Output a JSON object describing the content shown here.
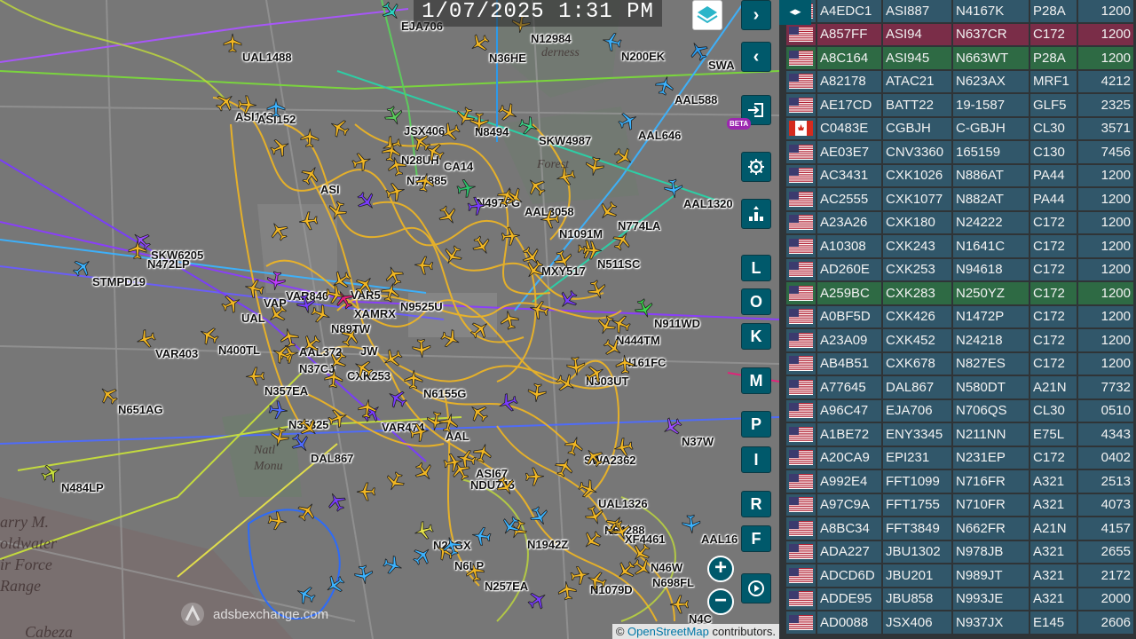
{
  "clock": "1/07/2025 1:31 PM",
  "attribution": {
    "prefix": "©",
    "link": "OpenStreetMap",
    "suffix": "contributors."
  },
  "watermark": "adsbexchange.com",
  "beta": "BETA",
  "places": [
    "arry M.",
    "oldwater",
    "ir Force",
    "Range",
    "Cabeza",
    "Natl",
    "Monu",
    "derness",
    "Forest"
  ],
  "map_buttons": {
    "layers": "layers-icon",
    "next": "›",
    "prev": "‹",
    "login": "login-icon",
    "settings": "gear-icon",
    "altitude": "altitude-icon",
    "keys": [
      "L",
      "O",
      "K",
      "M",
      "P",
      "I",
      "R",
      "F"
    ],
    "zoom_in": "+",
    "zoom_out": "−",
    "replay": "replay-icon"
  },
  "panel_toggle": "◂▸",
  "aircraft_labels": [
    "UAL1488",
    "ASI142",
    "ASI152",
    "EJA706",
    "N12984",
    "N36HE",
    "N200EK",
    "SWA",
    "AAL588",
    "AAL646",
    "SKW4987",
    "JSX406",
    "N8494",
    "N28UH",
    "CA14",
    "N72885",
    "ASI",
    "N497FG",
    "AAL3058",
    "AAL1320",
    "N774LA",
    "N1091M",
    "SKW6205",
    "N472LP",
    "STMPD19",
    "N511SC",
    "MXY517",
    "VAR840",
    "VAR5",
    "VAP",
    "XAMRX",
    "N9525U",
    "UAL",
    "N89TW",
    "N911WD",
    "N444TM",
    "VAR403",
    "N400TL",
    "AAL372",
    "JW",
    "N37CJ",
    "N161FC",
    "N303UT",
    "CXK253",
    "N357EA",
    "N651AG",
    "N6155G",
    "VAR474",
    "N35325",
    "DAL867",
    "AAL",
    "N37W",
    "ASI67",
    "NDU745",
    "SWA2362",
    "N484LP",
    "UAL1326",
    "N54288",
    "N1942Z",
    "N26GX",
    "N6LP",
    "N257EA",
    "XF4461",
    "N1079D",
    "N698FL",
    "AAL16",
    "N46W",
    "N4C"
  ],
  "aircraft_table": [
    {
      "flag": "US",
      "hex": "A4EDC1",
      "callsign": "ASI887",
      "reg": "N4167K",
      "type": "P28A",
      "squawk": "1200"
    },
    {
      "flag": "US",
      "hex": "A857FF",
      "callsign": "ASI94",
      "reg": "N637CR",
      "type": "C172",
      "squawk": "1200",
      "row": "red"
    },
    {
      "flag": "US",
      "hex": "A8C164",
      "callsign": "ASI945",
      "reg": "N663WT",
      "type": "P28A",
      "squawk": "1200",
      "row": "green"
    },
    {
      "flag": "US",
      "hex": "A82178",
      "callsign": "ATAC21",
      "reg": "N623AX",
      "type": "MRF1",
      "squawk": "4212"
    },
    {
      "flag": "US",
      "hex": "AE17CD",
      "callsign": "BATT22",
      "reg": "19-1587",
      "type": "GLF5",
      "squawk": "2325"
    },
    {
      "flag": "CA",
      "hex": "C0483E",
      "callsign": "CGBJH",
      "reg": "C-GBJH",
      "type": "CL30",
      "squawk": "3571"
    },
    {
      "flag": "US",
      "hex": "AE03E7",
      "callsign": "CNV3360",
      "reg": "165159",
      "type": "C130",
      "squawk": "7456"
    },
    {
      "flag": "US",
      "hex": "AC3431",
      "callsign": "CXK1026",
      "reg": "N886AT",
      "type": "PA44",
      "squawk": "1200"
    },
    {
      "flag": "US",
      "hex": "AC2555",
      "callsign": "CXK1077",
      "reg": "N882AT",
      "type": "PA44",
      "squawk": "1200"
    },
    {
      "flag": "US",
      "hex": "A23A26",
      "callsign": "CXK180",
      "reg": "N24222",
      "type": "C172",
      "squawk": "1200"
    },
    {
      "flag": "US",
      "hex": "A10308",
      "callsign": "CXK243",
      "reg": "N1641C",
      "type": "C172",
      "squawk": "1200"
    },
    {
      "flag": "US",
      "hex": "AD260E",
      "callsign": "CXK253",
      "reg": "N94618",
      "type": "C172",
      "squawk": "1200"
    },
    {
      "flag": "US",
      "hex": "A259BC",
      "callsign": "CXK283",
      "reg": "N250YZ",
      "type": "C172",
      "squawk": "1200",
      "row": "green"
    },
    {
      "flag": "US",
      "hex": "A0BF5D",
      "callsign": "CXK426",
      "reg": "N1472P",
      "type": "C172",
      "squawk": "1200"
    },
    {
      "flag": "US",
      "hex": "A23A09",
      "callsign": "CXK452",
      "reg": "N24218",
      "type": "C172",
      "squawk": "1200"
    },
    {
      "flag": "US",
      "hex": "AB4B51",
      "callsign": "CXK678",
      "reg": "N827ES",
      "type": "C172",
      "squawk": "1200"
    },
    {
      "flag": "US",
      "hex": "A77645",
      "callsign": "DAL867",
      "reg": "N580DT",
      "type": "A21N",
      "squawk": "7732"
    },
    {
      "flag": "US",
      "hex": "A96C47",
      "callsign": "EJA706",
      "reg": "N706QS",
      "type": "CL30",
      "squawk": "0510"
    },
    {
      "flag": "US",
      "hex": "A1BE72",
      "callsign": "ENY3345",
      "reg": "N211NN",
      "type": "E75L",
      "squawk": "4343"
    },
    {
      "flag": "US",
      "hex": "A20CA9",
      "callsign": "EPI231",
      "reg": "N231EP",
      "type": "C172",
      "squawk": "0402"
    },
    {
      "flag": "US",
      "hex": "A992E4",
      "callsign": "FFT1099",
      "reg": "N716FR",
      "type": "A321",
      "squawk": "2513"
    },
    {
      "flag": "US",
      "hex": "A97C9A",
      "callsign": "FFT1755",
      "reg": "N710FR",
      "type": "A321",
      "squawk": "4073"
    },
    {
      "flag": "US",
      "hex": "A8BC34",
      "callsign": "FFT3849",
      "reg": "N662FR",
      "type": "A21N",
      "squawk": "4157"
    },
    {
      "flag": "US",
      "hex": "ADA227",
      "callsign": "JBU1302",
      "reg": "N978JB",
      "type": "A321",
      "squawk": "2655"
    },
    {
      "flag": "US",
      "hex": "ADCD6D",
      "callsign": "JBU201",
      "reg": "N989JT",
      "type": "A321",
      "squawk": "2172"
    },
    {
      "flag": "US",
      "hex": "ADDE95",
      "callsign": "JBU858",
      "reg": "N993JE",
      "type": "A321",
      "squawk": "2000"
    },
    {
      "flag": "US",
      "hex": "AD0088",
      "callsign": "JSX406",
      "reg": "N937JX",
      "type": "E145",
      "squawk": "2606"
    }
  ]
}
